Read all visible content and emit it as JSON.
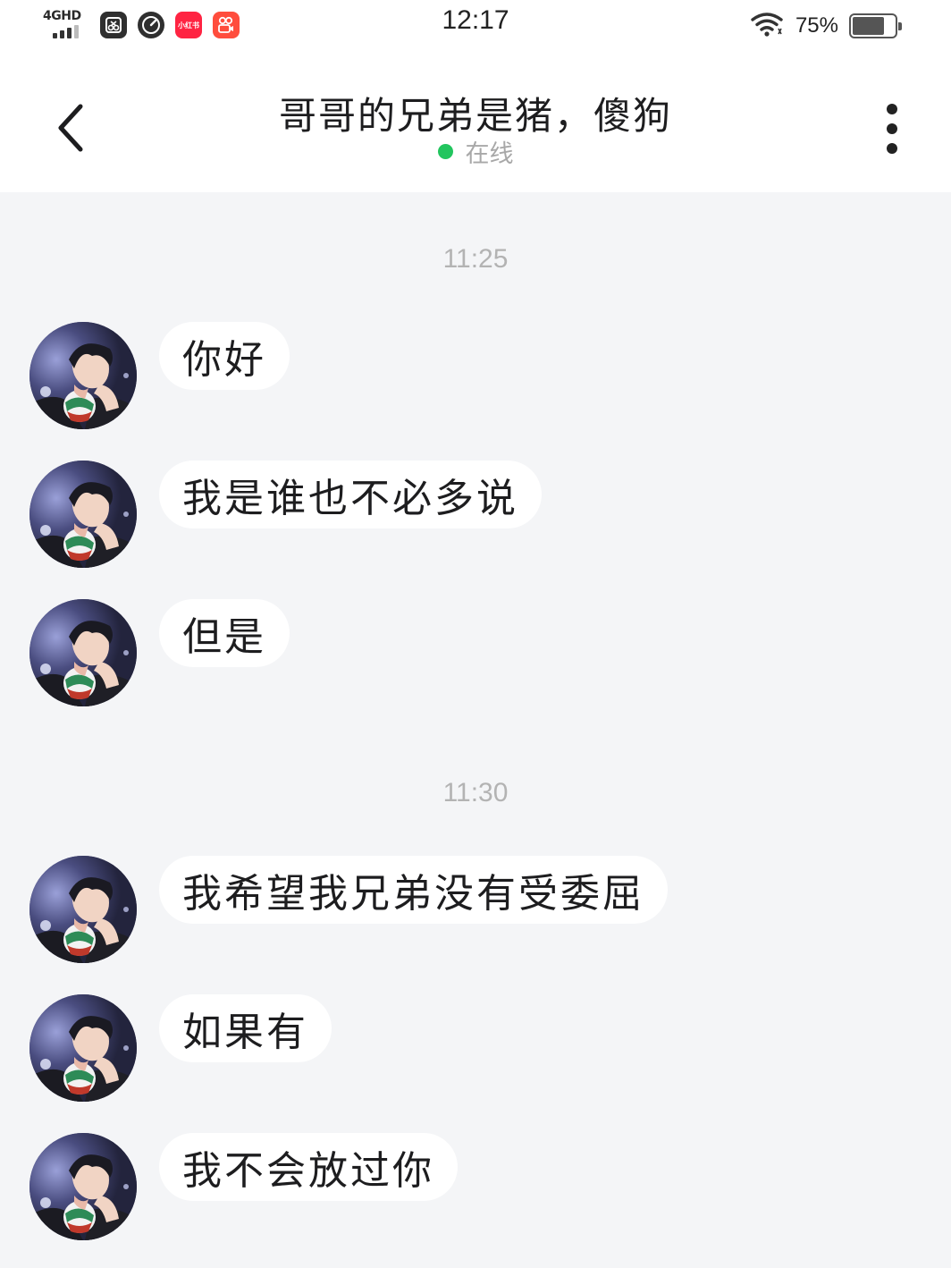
{
  "status_bar": {
    "network": "4GHD",
    "time": "12:17",
    "battery_percent": "75%",
    "battery_level": 0.75,
    "icons": [
      "signal-icon",
      "screen-capture-icon",
      "speed-icon",
      "xiaohongshu-icon",
      "kuaishou-icon",
      "wifi-icon",
      "battery-icon"
    ],
    "xiaohongshu_label": "小红书"
  },
  "header": {
    "title": "哥哥的兄弟是猪，傻狗",
    "status": "在线",
    "status_color": "#22c55e"
  },
  "chat": {
    "timestamps": [
      "11:25",
      "11:30"
    ],
    "messages": [
      {
        "text": "你好"
      },
      {
        "text": "我是谁也不必多说"
      },
      {
        "text": "但是"
      },
      {
        "text": "我希望我兄弟没有受委屈"
      },
      {
        "text": "如果有"
      },
      {
        "text": "我不会放过你"
      }
    ]
  }
}
